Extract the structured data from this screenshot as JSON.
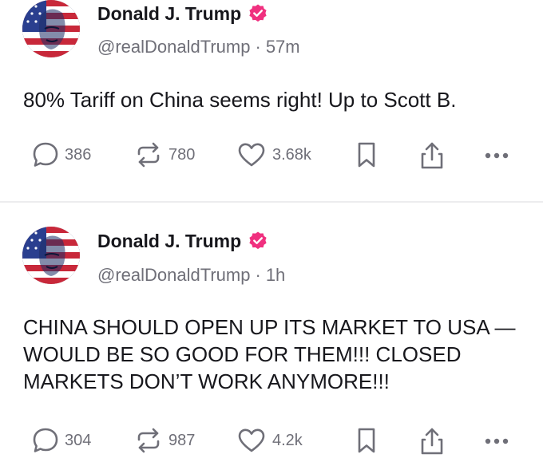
{
  "posts": [
    {
      "author_name": "Donald J. Trump",
      "handle": "@realDonaldTrump",
      "separator": "·",
      "time": "57m",
      "text": "80% Tariff on China seems right! Up to Scott B.",
      "replies": "386",
      "reposts": "780",
      "likes": "3.68k"
    },
    {
      "author_name": "Donald J. Trump",
      "handle": "@realDonaldTrump",
      "separator": "·",
      "time": "1h",
      "text": "CHINA SHOULD OPEN UP ITS MARKET TO USA — WOULD BE SO GOOD FOR THEM!!! CLOSED MARKETS DON’T WORK ANYMORE!!!",
      "replies": "304",
      "reposts": "987",
      "likes": "4.2k"
    }
  ],
  "icons": {
    "verified": "verified-badge-icon",
    "reply": "reply-bubble-icon",
    "repost": "repost-arrows-icon",
    "like": "heart-icon",
    "save": "bookmark-icon",
    "share": "share-icon",
    "more": "more-dots-icon"
  },
  "colors": {
    "verified_badge": "#f0307f",
    "text_primary": "#17171c",
    "text_secondary": "#6f6f78",
    "divider": "#ececee"
  }
}
